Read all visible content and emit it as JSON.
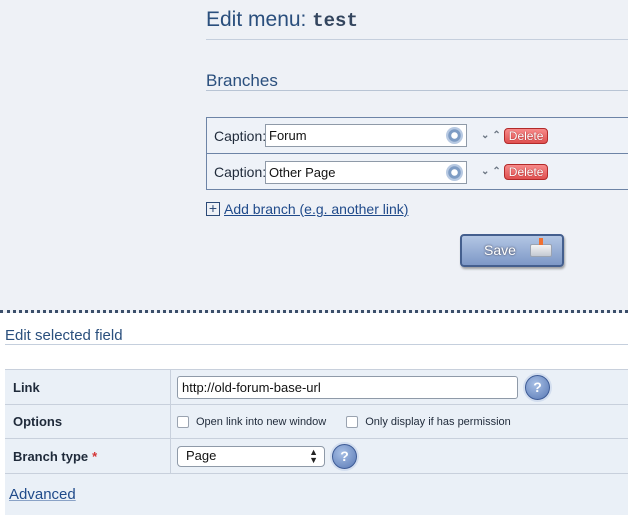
{
  "header": {
    "title_prefix": "Edit menu:",
    "menu_name": "test"
  },
  "branches": {
    "title": "Branches",
    "caption_label": "Caption:",
    "items": [
      {
        "caption": "Forum",
        "delete_label": "Delete"
      },
      {
        "caption": "Other Page",
        "delete_label": "Delete"
      }
    ],
    "add_label": "Add branch (e.g. another link)",
    "save_label": "Save"
  },
  "edit_field": {
    "title": "Edit selected field",
    "link_label": "Link",
    "link_value": "http://old-forum-base-url",
    "options_label": "Options",
    "option_new_window": "Open link into new window",
    "option_permission": "Only display if has permission",
    "branch_type_label": "Branch type",
    "required_marker": "*",
    "branch_type_value": "Page",
    "help_glyph": "?",
    "advanced_label": "Advanced"
  },
  "colors": {
    "accent": "#2a4f7d",
    "delete": "#e05050",
    "save": "#7d98c7"
  }
}
